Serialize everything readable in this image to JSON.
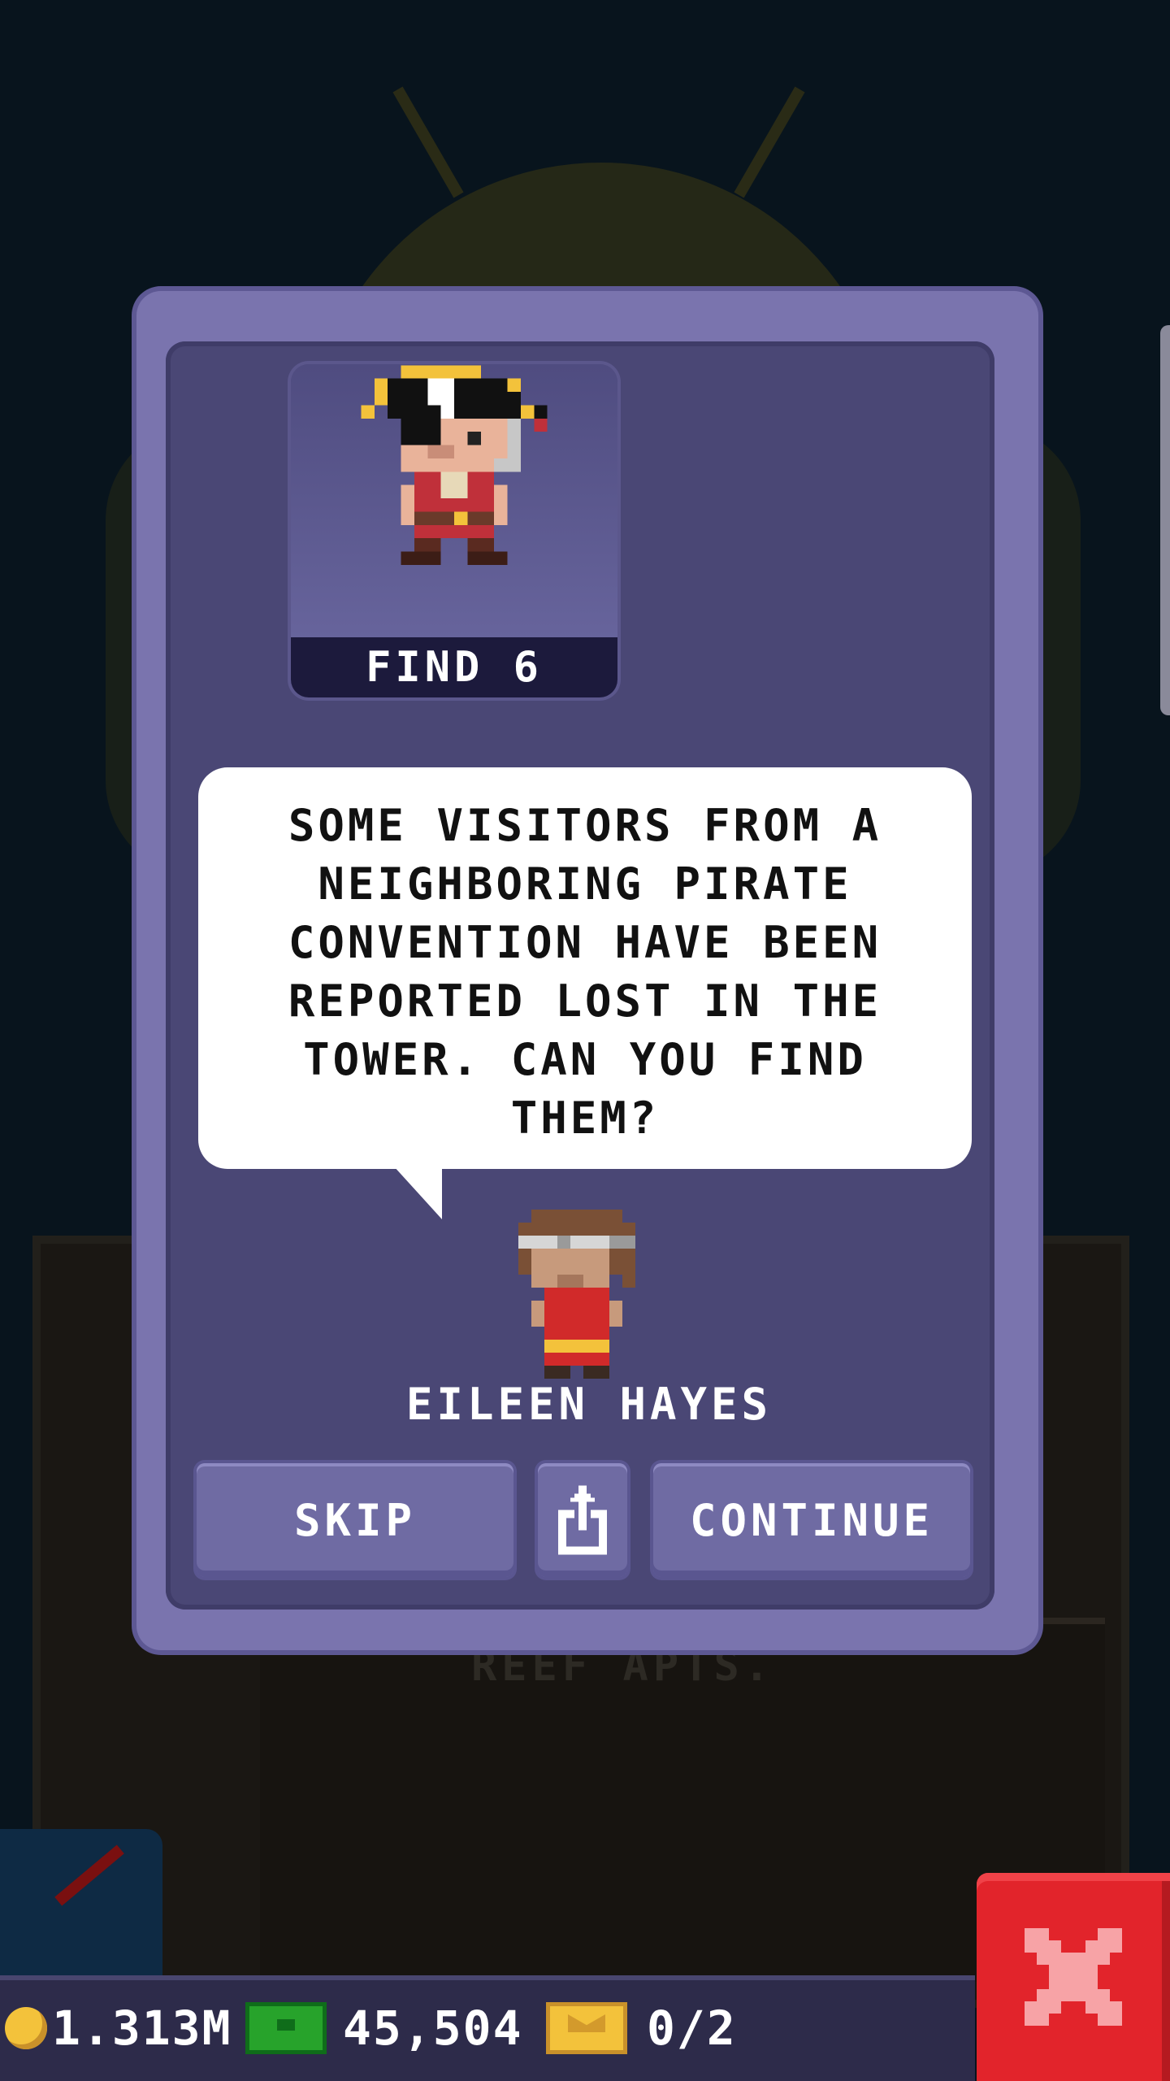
{
  "background": {
    "floor_label": "REEF APTS."
  },
  "dialog": {
    "mission": {
      "banner": "FIND 6",
      "portrait_icon": "pirate-character-icon"
    },
    "speech": {
      "text": "SOME VISITORS FROM A NEIGHBORING PIRATE CONVENTION HAVE BEEN REPORTED LOST IN THE TOWER. CAN YOU FIND THEM?"
    },
    "speaker": {
      "name": "EILEEN HAYES",
      "avatar_icon": "bitizen-avatar-icon"
    },
    "buttons": {
      "skip_label": "SKIP",
      "share_icon": "share-icon",
      "continue_label": "CONTINUE"
    }
  },
  "status_bar": {
    "coins": "1.313M",
    "bux": "45,504",
    "tickets": "0/2"
  },
  "close": {
    "icon": "close-icon"
  },
  "colors": {
    "dialog_outer": "#7a74ae",
    "dialog_inner": "#4a4775",
    "close_red": "#e2242b",
    "coin_gold": "#f3c23b",
    "bux_green": "#27a32b"
  }
}
